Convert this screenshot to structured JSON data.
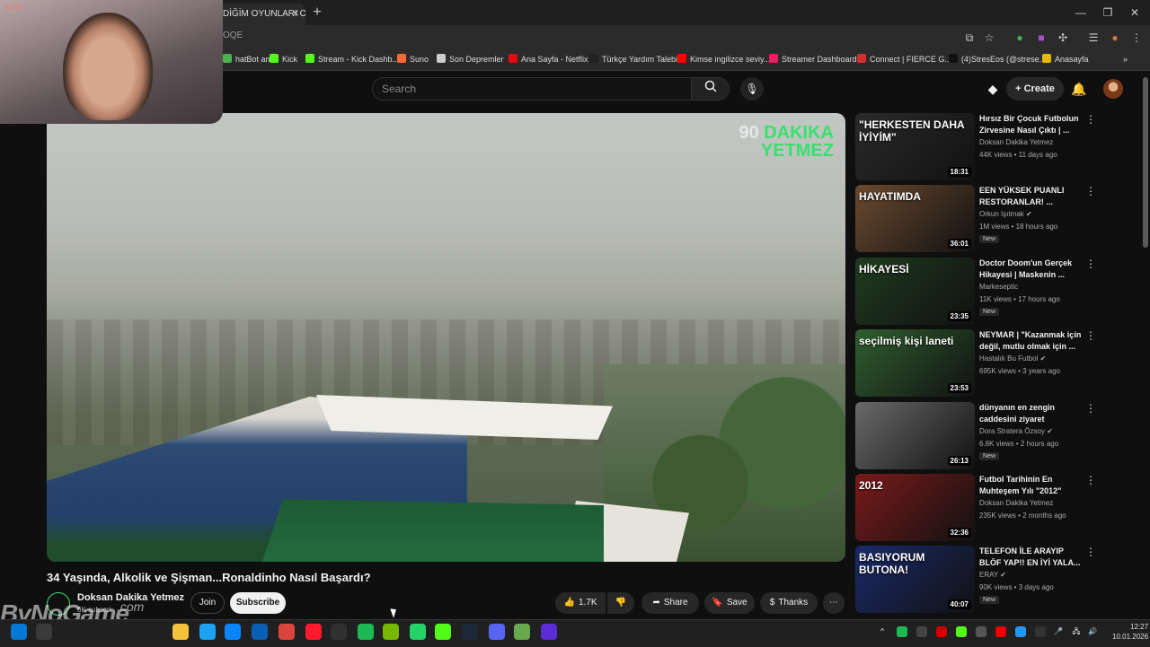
{
  "browser": {
    "tab_title": "DİĞİM OYUNLARI O",
    "url_fragment": "OQE",
    "bookmarks": [
      {
        "label": "hatBot an...",
        "color": "#4caf50"
      },
      {
        "label": "Kick",
        "color": "#53fc18"
      },
      {
        "label": "Stream - Kick Dashb...",
        "color": "#53fc18"
      },
      {
        "label": "Suno",
        "color": "#ff6b35"
      },
      {
        "label": "Son Depremler",
        "color": "#cccccc"
      },
      {
        "label": "Ana Sayfa - Netflix",
        "color": "#e50914"
      },
      {
        "label": "Türkçe Yardım Talebi",
        "color": "#222222"
      },
      {
        "label": "Kimse ingilizce seviy...",
        "color": "#ff0000"
      },
      {
        "label": "Streamer Dashboard",
        "color": "#e91e63"
      },
      {
        "label": "Connect | FIERCE G...",
        "color": "#d32f2f"
      },
      {
        "label": "(4)StresEos (@strese...",
        "color": "#111111"
      },
      {
        "label": "Anasayfa",
        "color": "#e6b800"
      }
    ]
  },
  "header": {
    "search_placeholder": "Search",
    "create_label": "Create"
  },
  "webcam": {
    "label": "4.1TL"
  },
  "video": {
    "watermark_number": "90",
    "watermark_line1": "DAKIKA",
    "watermark_line2": "YETMEZ",
    "title": "34 Yaşında, Alkolik ve Şişman...Ronaldinho Nasıl Başardı?",
    "channel_name": "Doksan Dakika Yetmez",
    "channel_subs": "5K subscri",
    "join_label": "Join",
    "subscribe_label": "Subscribe",
    "likes": "1.7K",
    "share_label": "Share",
    "save_label": "Save",
    "thanks_label": "Thanks"
  },
  "overlay": {
    "brand_main": "ByNoGame",
    "brand_suffix": ".com"
  },
  "recommendations": [
    {
      "title": "Hırsız Bir Çocuk Futbolun Zirvesine Nasıl Çıktı | ...",
      "channel": "Doksan Dakika Yetmez",
      "meta": "44K views • 11 days ago",
      "duration": "18:31",
      "thumb_text": "\"HERKESTEN DAHA İYİYİM\"",
      "bg": "#2a2a2a",
      "new": "",
      "verified": false
    },
    {
      "title": "EEN YÜKSEK PUANLI RESTORANLAR! ...",
      "channel": "Orkun Işıtmak",
      "meta": "1M views • 18 hours ago",
      "duration": "36:01",
      "thumb_text": "HAYATIMDA",
      "bg": "#6b4a30",
      "new": "New",
      "verified": true
    },
    {
      "title": "Doctor Doom'un Gerçek Hikayesi | Maskenin ...",
      "channel": "Markeseptic",
      "meta": "11K views • 17 hours ago",
      "duration": "23:35",
      "thumb_text": "HİKAYESİ",
      "bg": "#1f3b1e",
      "new": "New",
      "verified": false
    },
    {
      "title": "NEYMAR | \"Kazanmak için değil, mutlu olmak için ...",
      "channel": "Hastalık Bu Futbol",
      "meta": "695K views • 3 years ago",
      "duration": "23:53",
      "thumb_text": "seçilmiş kişi laneti",
      "bg": "#2f5e2f",
      "new": "",
      "verified": true
    },
    {
      "title": "dünyanın en zengin caddesini ziyaret",
      "channel": "Dora Stratera Özsoy",
      "meta": "6.8K views • 2 hours ago",
      "duration": "26:13",
      "thumb_text": "",
      "bg": "#6a6a6a",
      "new": "New",
      "verified": true
    },
    {
      "title": "Futbol Tarihinin En Muhteşem Yılı \"2012\"",
      "channel": "Doksan Dakika Yetmez",
      "meta": "235K views • 2 months ago",
      "duration": "32:36",
      "thumb_text": "2012",
      "bg": "#7a1a1a",
      "new": "",
      "verified": false
    },
    {
      "title": "TELEFON İLE ARAYIP BLÖF YAP!! EN İYİ YALA...",
      "channel": "ERAY",
      "meta": "90K views • 3 days ago",
      "duration": "40:07",
      "thumb_text": "BASIYORUM BUTONA!",
      "bg": "#1a2a6a",
      "new": "New",
      "verified": true
    }
  ],
  "taskbar": {
    "time": "12:27",
    "date": "10.01.2026",
    "apps": [
      {
        "icon": "windows-icon",
        "color": "#0078d4"
      },
      {
        "icon": "search-icon",
        "color": "#3a3a3a"
      },
      {
        "icon": "explorer-icon",
        "color": "#f3c13a"
      },
      {
        "icon": "edge-icon",
        "color": "#1da1f2"
      },
      {
        "icon": "store-icon",
        "color": "#0a84ff"
      },
      {
        "icon": "outlook-icon",
        "color": "#0a5fb4"
      },
      {
        "icon": "chrome-icon",
        "color": "#d9453d"
      },
      {
        "icon": "opera-icon",
        "color": "#ff1b2d"
      },
      {
        "icon": "obs-icon",
        "color": "#303030"
      },
      {
        "icon": "spotify-icon",
        "color": "#1db954"
      },
      {
        "icon": "nvidia-icon",
        "color": "#76b900"
      },
      {
        "icon": "whatsapp-icon",
        "color": "#25d366"
      },
      {
        "icon": "kick-icon",
        "color": "#53fc18"
      },
      {
        "icon": "steam-icon",
        "color": "#1b2838"
      },
      {
        "icon": "discord-icon",
        "color": "#5865f2"
      },
      {
        "icon": "minecraft-icon",
        "color": "#6aa84f"
      },
      {
        "icon": "app-icon",
        "color": "#5b2bd6"
      }
    ]
  }
}
